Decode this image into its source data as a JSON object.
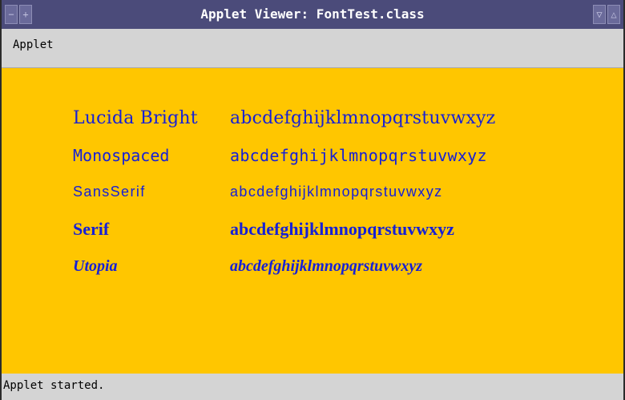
{
  "window": {
    "title": "Applet Viewer: FontTest.class"
  },
  "menubar": {
    "items": [
      "Applet"
    ]
  },
  "canvas": {
    "background": "#ffc600",
    "text_color": "#1620d6",
    "rows": [
      {
        "font": "Lucida Bright",
        "sample": "abcdefghijklmnopqrstuvwxyz"
      },
      {
        "font": "Monospaced",
        "sample": "abcdefghijklmnopqrstuvwxyz"
      },
      {
        "font": "SansSerif",
        "sample": "abcdefghijklmnopqrstuvwxyz"
      },
      {
        "font": "Serif",
        "sample": "abcdefghijklmnopqrstuvwxyz"
      },
      {
        "font": "Utopia",
        "sample": "abcdefghijklmnopqrstuvwxyz"
      }
    ]
  },
  "status": {
    "text": "Applet started."
  },
  "icons": {
    "window_menu": "minus-icon",
    "window_move": "plus-icon",
    "minimize": "triangle-down-icon",
    "maximize": "triangle-up-icon"
  }
}
